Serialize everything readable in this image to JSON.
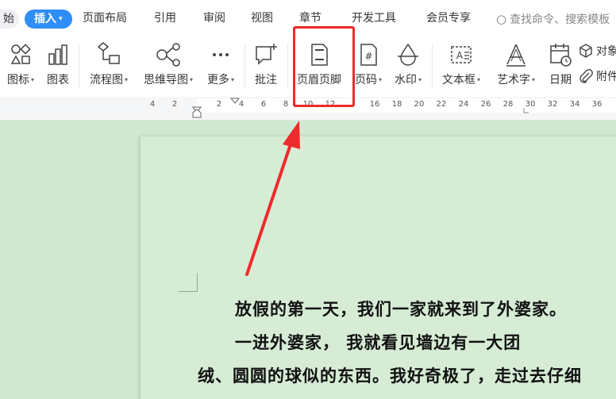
{
  "tabs": [
    {
      "label": "始"
    },
    {
      "label": "插入"
    },
    {
      "label": "页面布局"
    },
    {
      "label": "引用"
    },
    {
      "label": "审阅"
    },
    {
      "label": "视图"
    },
    {
      "label": "章节"
    },
    {
      "label": "开发工具"
    },
    {
      "label": "会员专享"
    }
  ],
  "search": {
    "placeholder": "查找命令、搜索模板"
  },
  "ribbon": {
    "icon_label": "图标",
    "chart_label": "图表",
    "flowchart_label": "流程图",
    "mindmap_label": "思维导图",
    "more_label": "更多",
    "comment_label": "批注",
    "header_footer_label": "页眉页脚",
    "page_number_label": "页码",
    "watermark_label": "水印",
    "textbox_label": "文本框",
    "wordart_label": "艺术字",
    "date_label": "日期",
    "object_label": "对象",
    "attachment_label": "附件"
  },
  "ruler": {
    "ticks": [
      "4",
      "2",
      "2",
      "4",
      "6",
      "8",
      "10",
      "12",
      "16",
      "18",
      "20",
      "22",
      "24",
      "26",
      "28",
      "30",
      "32",
      "34",
      "36"
    ]
  },
  "document": {
    "paragraphs": [
      "放假的第一天，我们一家就来到了外婆家。",
      "一进外婆家，          我就看见墙边有一大团",
      "绒、圆圆的球似的东西。我好奇极了，走过去仔细"
    ]
  },
  "colors": {
    "accent": "#2e8ef7",
    "highlight": "#ee2b2b",
    "page_bg": "#d6ecd5",
    "workspace_bg": "#cfe8cf"
  }
}
